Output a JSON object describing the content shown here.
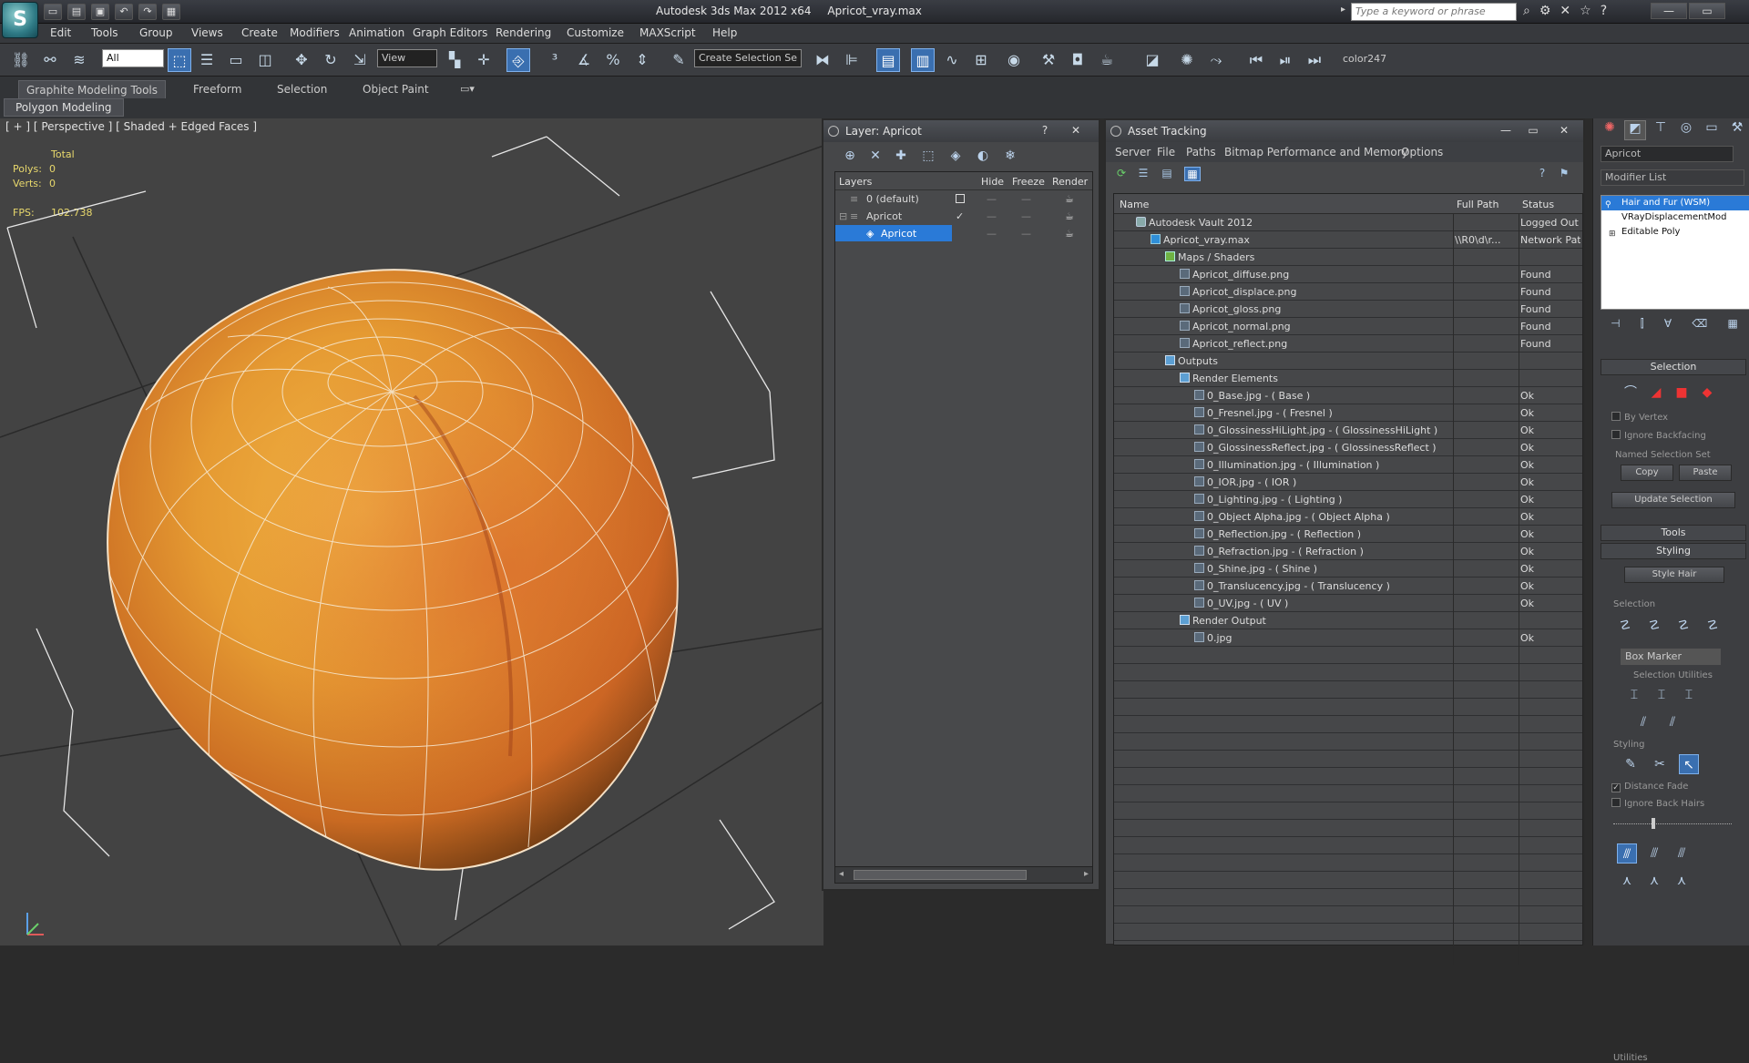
{
  "titlebar": {
    "app_name": "Autodesk 3ds Max  2012 x64",
    "file_name": "Apricot_vray.max",
    "search_placeholder": "Type a keyword or phrase",
    "logo_letter": "S"
  },
  "menu": [
    "Edit",
    "Tools",
    "Group",
    "Views",
    "Create",
    "Modifiers",
    "Animation",
    "Graph Editors",
    "Rendering",
    "Customize",
    "MAXScript",
    "Help"
  ],
  "toolbar": {
    "filter_value": "All",
    "ref_coord_value": "View",
    "selection_set_value": "Create Selection Se",
    "color_label": "color247"
  },
  "ribbon": {
    "tabs": [
      "Graphite Modeling Tools",
      "Freeform",
      "Selection",
      "Object Paint"
    ],
    "subtab": "Polygon Modeling"
  },
  "viewport": {
    "label": "[ + ] [ Perspective ] [ Shaded + Edged Faces ]",
    "stats_header": "Total",
    "polys_label": "Polys:",
    "polys_value": "0",
    "verts_label": "Verts:",
    "verts_value": "0",
    "fps_label": "FPS:",
    "fps_value": "102.738"
  },
  "layer_panel": {
    "title": "Layer: Apricot",
    "columns": [
      "Layers",
      "Hide",
      "Freeze",
      "Render"
    ],
    "rows": [
      {
        "name": "0 (default)"
      },
      {
        "name": "Apricot"
      },
      {
        "name": "Apricot"
      }
    ]
  },
  "asset_panel": {
    "title": "Asset Tracking",
    "menu": [
      "Server",
      "File",
      "Paths",
      "Bitmap Performance and Memory",
      "Options"
    ],
    "columns": [
      "Name",
      "Full Path",
      "Status"
    ],
    "rows": [
      {
        "name": "Autodesk Vault 2012",
        "path": "",
        "status": "Logged Out ..."
      },
      {
        "name": "Apricot_vray.max",
        "path": "\\\\R0\\d\\r...",
        "status": "Network Path"
      },
      {
        "name": "Maps / Shaders",
        "path": "",
        "status": ""
      },
      {
        "name": "Apricot_diffuse.png",
        "path": "",
        "status": "Found"
      },
      {
        "name": "Apricot_displace.png",
        "path": "",
        "status": "Found"
      },
      {
        "name": "Apricot_gloss.png",
        "path": "",
        "status": "Found"
      },
      {
        "name": "Apricot_normal.png",
        "path": "",
        "status": "Found"
      },
      {
        "name": "Apricot_reflect.png",
        "path": "",
        "status": "Found"
      },
      {
        "name": "Outputs",
        "path": "",
        "status": ""
      },
      {
        "name": "Render Elements",
        "path": "",
        "status": ""
      },
      {
        "name": "0_Base.jpg - ( Base )",
        "path": "",
        "status": "Ok"
      },
      {
        "name": "0_Fresnel.jpg - ( Fresnel )",
        "path": "",
        "status": "Ok"
      },
      {
        "name": "0_GlossinessHiLight.jpg - ( GlossinessHiLight )",
        "path": "",
        "status": "Ok"
      },
      {
        "name": "0_GlossinessReflect.jpg - ( GlossinessReflect )",
        "path": "",
        "status": "Ok"
      },
      {
        "name": "0_Illumination.jpg - ( Illumination )",
        "path": "",
        "status": "Ok"
      },
      {
        "name": "0_IOR.jpg - ( IOR )",
        "path": "",
        "status": "Ok"
      },
      {
        "name": "0_Lighting.jpg - ( Lighting )",
        "path": "",
        "status": "Ok"
      },
      {
        "name": "0_Object Alpha.jpg - ( Object Alpha )",
        "path": "",
        "status": "Ok"
      },
      {
        "name": "0_Reflection.jpg - ( Reflection )",
        "path": "",
        "status": "Ok"
      },
      {
        "name": "0_Refraction.jpg - ( Refraction )",
        "path": "",
        "status": "Ok"
      },
      {
        "name": "0_Shine.jpg - ( Shine )",
        "path": "",
        "status": "Ok"
      },
      {
        "name": "0_Translucency.jpg - ( Translucency )",
        "path": "",
        "status": "Ok"
      },
      {
        "name": "0_UV.jpg - ( UV )",
        "path": "",
        "status": "Ok"
      },
      {
        "name": "Render Output",
        "path": "",
        "status": ""
      },
      {
        "name": "0.jpg",
        "path": "",
        "status": "Ok"
      }
    ]
  },
  "command_panel": {
    "object_name": "Apricot",
    "modifier_list": "Modifier List",
    "modifiers": [
      "Hair and Fur (WSM)",
      "VRayDisplacementMod",
      "Editable Poly"
    ],
    "selection_rollout": "Selection",
    "by_vertex": "By Vertex",
    "ignore_backfacing": "Ignore Backfacing",
    "named_selection_set": "Named Selection Set",
    "copy": "Copy",
    "paste": "Paste",
    "update_selection": "Update Selection",
    "tools_rollout": "Tools",
    "styling_rollout": "Styling",
    "style_hair": "Style Hair",
    "selection_group": "Selection",
    "box_marker": "Box Marker",
    "selection_utilities": "Selection Utilities",
    "styling_group": "Styling",
    "distance_fade": "Distance Fade",
    "ignore_back_hairs": "Ignore Back Hairs",
    "utilities": "Utilities"
  },
  "colors": {
    "accent": "#2a7ad7",
    "stats": "#e8d86c",
    "fruit": "#e08a2a"
  }
}
